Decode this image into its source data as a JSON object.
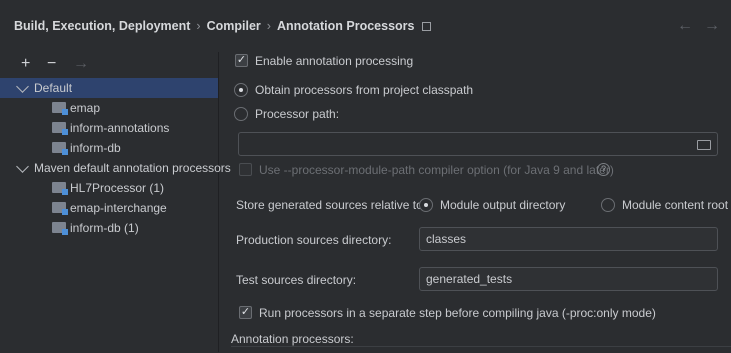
{
  "header": {
    "breadcrumb": [
      "Build, Execution, Deployment",
      "Compiler",
      "Annotation Processors"
    ],
    "back_icon": "arrow-left-icon",
    "forward_icon": "arrow-right-icon"
  },
  "toolbar": {
    "add": "+",
    "remove": "−",
    "move": "→"
  },
  "tree": {
    "group1": "Default",
    "group1_items": [
      "emap",
      "inform-annotations",
      "inform-db"
    ],
    "group2": "Maven default annotation processors",
    "group2_items": [
      "HL7Processor (1)",
      "emap-interchange",
      "inform-db (1)"
    ]
  },
  "settings": {
    "enable_label": "Enable annotation processing",
    "enable_checked": true,
    "obtain_label": "Obtain processors from project classpath",
    "processor_path_label": "Processor path:",
    "processor_path_value": "",
    "module_path_label": "Use --processor-module-path compiler option (for Java 9 and later)",
    "help_glyph": "?",
    "store_label": "Store generated sources relative to:",
    "module_output_label": "Module output directory",
    "module_content_label": "Module content root",
    "production_label": "Production sources directory:",
    "production_value": "classes",
    "test_label": "Test sources directory:",
    "test_value": "generated_tests",
    "separate_step_label": "Run processors in a separate step before compiling java (-proc:only mode)",
    "separate_step_checked": true,
    "annotation_processors_label": "Annotation processors:"
  },
  "colors": {
    "background": "#2b2d30",
    "selection": "#2e436e",
    "text": "#c9cbcf"
  }
}
